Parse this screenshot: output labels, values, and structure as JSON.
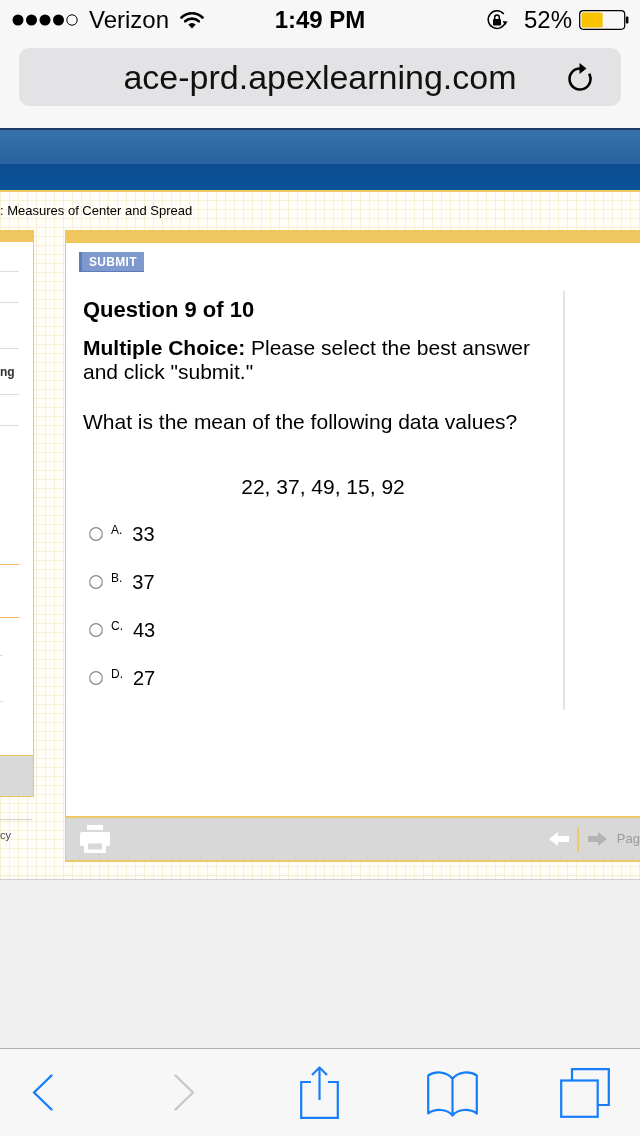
{
  "status_bar": {
    "carrier": "Verizon",
    "time": "1:49 PM",
    "battery": "52%"
  },
  "address_bar": {
    "url": "ace-prd.apexlearning.com"
  },
  "breadcrumb": ": Measures of Center and Spread",
  "side_panel": {
    "item_label": "ng",
    "footer_label": "cy"
  },
  "question": {
    "submit_label": "SUBMIT",
    "heading": "Question 9 of 10",
    "instruction": "**Multiple Choice:** Please select the best answer and click \"submit.\"",
    "prompt": "What is the mean of the following data values?",
    "data_values": "22, 37, 49, 15, 92",
    "options": [
      {
        "letter": "A.",
        "value": "33",
        "selected": false
      },
      {
        "letter": "B.",
        "value": "37",
        "selected": false
      },
      {
        "letter": "C.",
        "value": "43",
        "selected": false
      },
      {
        "letter": "D.",
        "value": "27",
        "selected": false
      }
    ]
  },
  "pager": {
    "previous": {
      "disabled": false
    },
    "next": {
      "disabled": true
    },
    "page_label": "Pag"
  },
  "browser_toolbar": {
    "back": {
      "disabled": false
    },
    "forward": {
      "disabled": true
    }
  }
}
